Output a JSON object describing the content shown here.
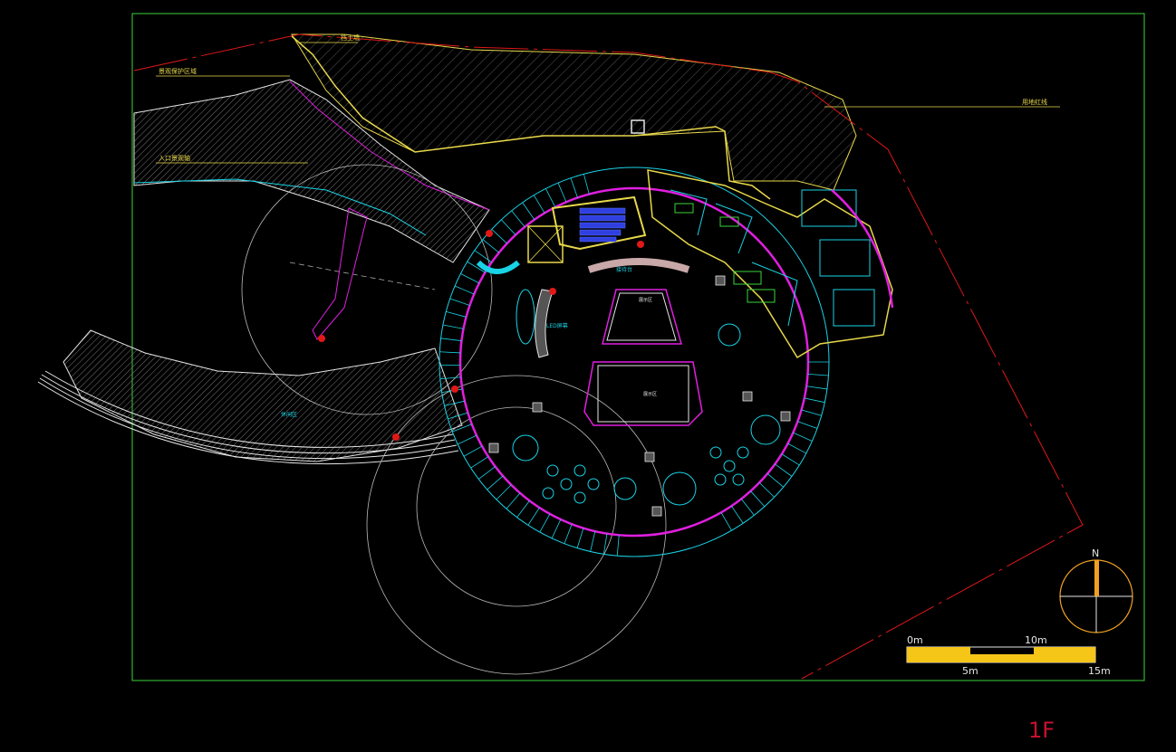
{
  "drawing": {
    "floor_label": "1F",
    "colors": {
      "background": "#000000",
      "frame": "#3bd33b",
      "boundary_red": "#e01818",
      "yellow": "#e8d84a",
      "cyan": "#19d3e6",
      "magenta": "#e01fe0",
      "white": "#e6e6e6",
      "orange": "#f0a020",
      "blue": "#3040e0"
    }
  },
  "compass": {
    "north_label": "N"
  },
  "scale_bar": {
    "top_labels": [
      "0m",
      "10m"
    ],
    "bottom_labels": [
      "5m",
      "15m"
    ]
  },
  "annotations": {
    "top_leaders": [
      "挡土墙",
      "景观保护区域",
      "入口景观轴",
      "用地红线"
    ],
    "small_texts": [
      "LED屏幕",
      "接待台",
      "展示区",
      "展示区",
      "休闲区"
    ]
  }
}
